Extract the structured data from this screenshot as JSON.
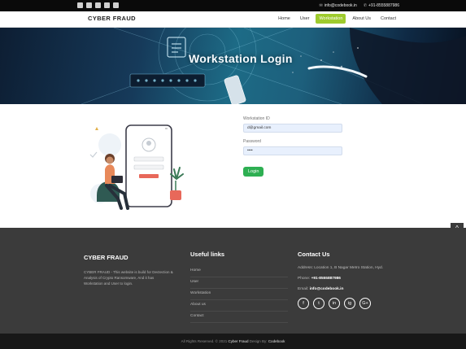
{
  "topbar": {
    "social_icons": [
      "facebook-icon",
      "instagram-icon",
      "linkedin-icon",
      "youtube-icon",
      "twitter-icon"
    ],
    "email": "info@codebook.in",
    "phone": "+91-8555887986"
  },
  "navbar": {
    "brand": "CYBER FRAUD",
    "items": [
      "Home",
      "User",
      "Workstation",
      "About Us",
      "Contact"
    ],
    "active": "Workstation",
    "active_color": "#9ecb2d"
  },
  "hero": {
    "title": "Workstation Login"
  },
  "login_form": {
    "id_label": "Workstation ID",
    "id_value": "d@gmail.com",
    "password_label": "Password",
    "password_value": "••••",
    "submit_label": "Login",
    "button_color": "#2eaf52"
  },
  "footer": {
    "about": {
      "title": "CYBER FRAUD",
      "text": "CYBER FRAUD - This website is build for Dectection & Analysis of Crypto Ransomware, And it has Workstation and User to login."
    },
    "links": {
      "title": "Useful links",
      "items": [
        "Home",
        "User",
        "Workstation",
        "About us",
        "Contact"
      ]
    },
    "contact": {
      "title": "Contact Us",
      "address": "Address: Location 1, B Nagar Metro Station, Hyd.",
      "phone_label": "Phone:",
      "phone": "+91-8555887986",
      "email_label": "Email:",
      "email": "info@codebook.in",
      "social": [
        "f",
        "t",
        "in",
        "ig",
        "G+"
      ]
    },
    "copyright_prefix": "All Rights Reserved. © 2021",
    "copyright_brand": "Cyber Fraud",
    "design_prefix": "Design By:",
    "design_brand": "Codebook"
  },
  "scroll_top": "^"
}
